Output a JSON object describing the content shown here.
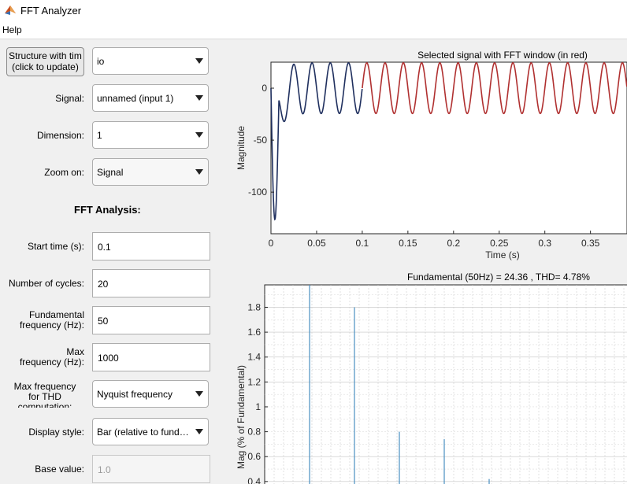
{
  "window": {
    "title": "FFT Analyzer"
  },
  "menu": {
    "help": "Help"
  },
  "controls": {
    "update_button_line1": "Structure with tim",
    "update_button_line2": "(click to update)",
    "structure_value": "io",
    "signal_label": "Signal:",
    "signal_value": "unnamed (input 1)",
    "dimension_label": "Dimension:",
    "dimension_value": "1",
    "zoom_label": "Zoom on:",
    "zoom_value": "Signal",
    "fft_heading": "FFT Analysis:",
    "start_time_label": "Start time (s):",
    "start_time_value": "0.1",
    "cycles_label": "Number of cycles:",
    "cycles_value": "20",
    "fundamental_label_1": "Fundamental",
    "fundamental_label_2": "frequency (Hz):",
    "fundamental_value": "50",
    "max_freq_label_1": "Max",
    "max_freq_label_2": "frequency (Hz):",
    "max_freq_value": "1000",
    "thd_label_1": "Max frequency",
    "thd_label_2": "for THD",
    "thd_label_3": "computation:",
    "thd_value": "Nyquist frequency",
    "display_style_label": "Display style:",
    "display_style_value": "Bar (relative to fund…",
    "base_value_label": "Base value:",
    "base_value_value": "1.0"
  },
  "chart_data": [
    {
      "type": "line",
      "title": "Selected signal with FFT window (in red)",
      "xlabel": "Time (s)",
      "ylabel": "Magnitude",
      "xlim": [
        0,
        0.39
      ],
      "ylim": [
        -140,
        25
      ],
      "x_ticks": [
        "0",
        "0.05",
        "0.1",
        "0.15",
        "0.2",
        "0.25",
        "0.3",
        "0.35"
      ],
      "y_ticks": [
        "0",
        "-50",
        "-100"
      ],
      "grid": false,
      "signal": {
        "frequency_hz": 50,
        "amplitude": 24.4,
        "transient_minimum": -140,
        "transient_end_s": 0.009
      },
      "series": [
        {
          "name": "",
          "color": "#1f2f5e",
          "x_range": [
            0,
            0.1
          ]
        },
        {
          "name": "",
          "color": "#b03030",
          "x_range": [
            0.1,
            0.39
          ]
        }
      ]
    },
    {
      "type": "bar",
      "title": "Fundamental (50Hz) = 24.36 , THD= 4.78%",
      "xlabel": "",
      "ylabel": "Mag (% of Fundamental)",
      "ylim": [
        0.38,
        1.98
      ],
      "y_ticks": [
        "1.8",
        "1.6",
        "1.4",
        "1.2",
        "1",
        "0.8",
        "0.6",
        "0.4"
      ],
      "grid": true,
      "x": [
        50,
        150,
        250,
        350,
        450
      ],
      "values": [
        100,
        1.8,
        0.8,
        0.74,
        0.42
      ],
      "color": "#4a8fc0"
    }
  ]
}
